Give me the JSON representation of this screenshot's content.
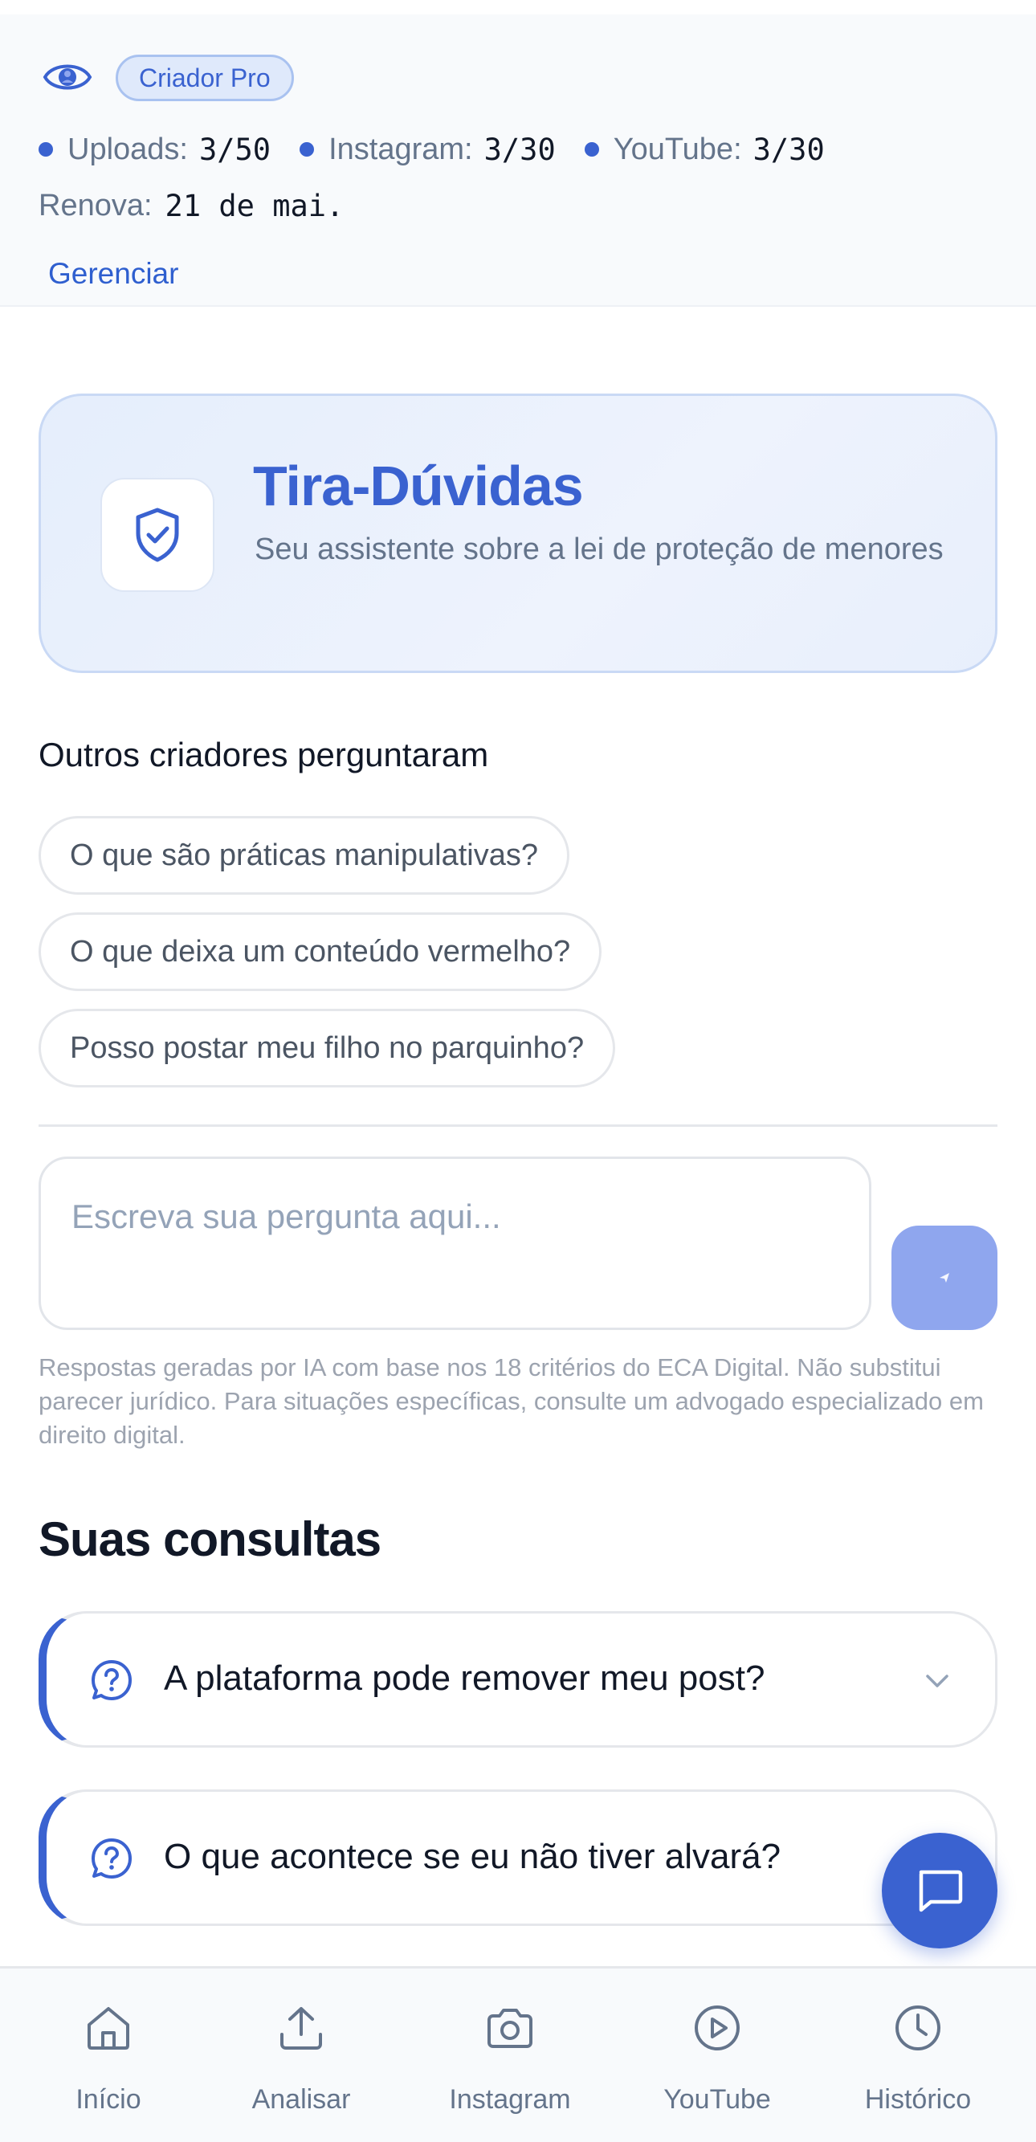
{
  "plan": {
    "badge": "Criador Pro",
    "usage": [
      {
        "label": "Uploads:",
        "value": "3/50"
      },
      {
        "label": "Instagram:",
        "value": "3/30"
      },
      {
        "label": "YouTube:",
        "value": "3/30"
      }
    ],
    "renew_label": "Renova:",
    "renew_value": "21 de mai.",
    "manage_label": "Gerenciar"
  },
  "hero": {
    "title": "Tira-Dúvidas",
    "subtitle": "Seu assistente sobre a lei de proteção de menores",
    "icon": "shield-check-icon"
  },
  "suggestions": {
    "heading": "Outros criadores perguntaram",
    "items": [
      "O que são práticas manipulativas?",
      "O que deixa um conteúdo vermelho?",
      "Posso postar meu filho no parquinho?"
    ]
  },
  "composer": {
    "placeholder": "Escreva sua pergunta aqui...",
    "send_icon": "send-icon",
    "disclaimer": "Respostas geradas por IA com base nos 18 critérios do ECA Digital. Não substitui parecer jurídico. Para situações específicas, consulte um advogado especializado em direito digital."
  },
  "history": {
    "heading": "Suas consultas",
    "items": [
      "A plataforma pode remover meu post?",
      "O que acontece se eu não tiver alvará?"
    ]
  },
  "nav": {
    "items": [
      {
        "label": "Início",
        "icon": "home-icon"
      },
      {
        "label": "Analisar",
        "icon": "upload-icon"
      },
      {
        "label": "Instagram",
        "icon": "camera-icon"
      },
      {
        "label": "YouTube",
        "icon": "play-icon"
      },
      {
        "label": "Histórico",
        "icon": "clock-icon"
      }
    ]
  },
  "colors": {
    "accent": "#3a62d0",
    "send_disabled": "#8fa6ee",
    "muted_text": "#64748b"
  }
}
